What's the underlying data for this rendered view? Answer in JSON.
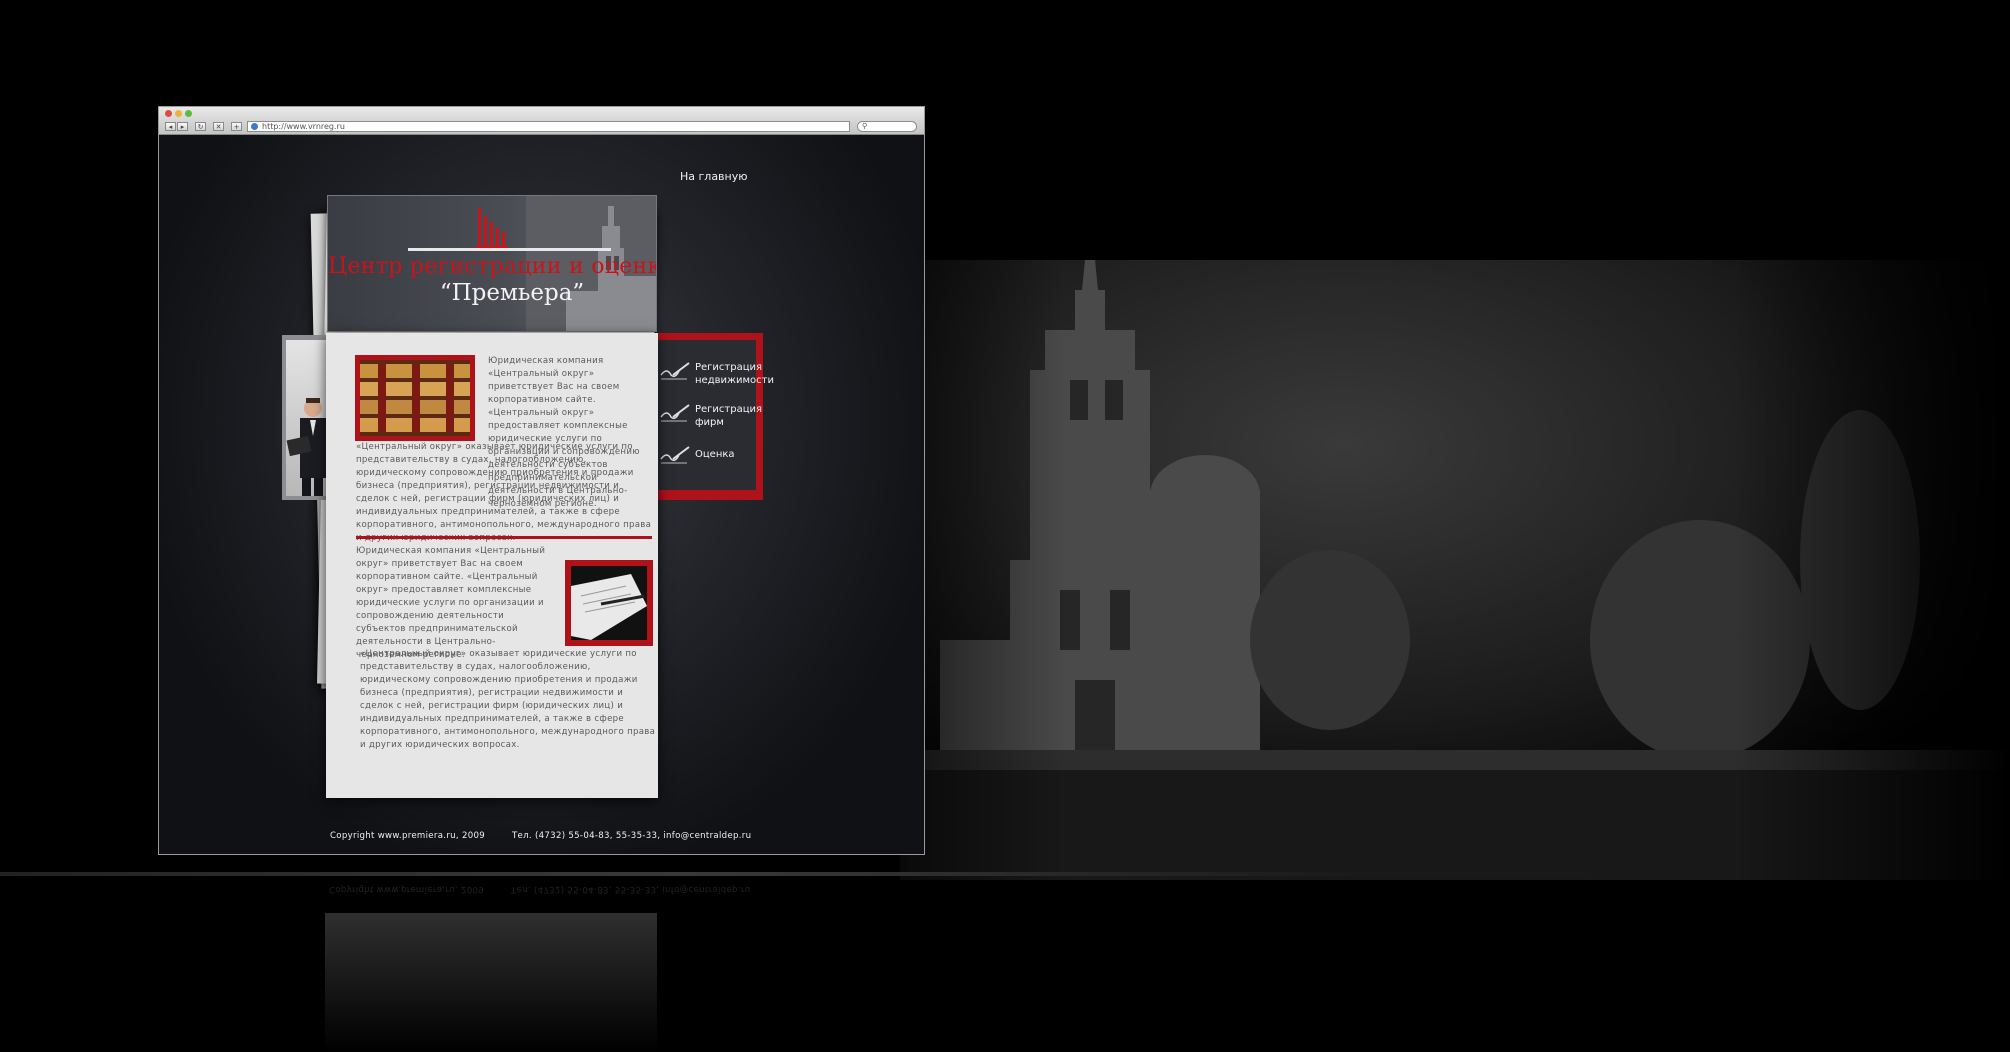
{
  "browser": {
    "url": "http://www.vrnreg.ru",
    "nav_buttons": [
      "◂",
      "▸",
      "↻",
      "✕",
      "+"
    ],
    "search_glyph": "⚲"
  },
  "site": {
    "home_link": "На главную",
    "title": "Центр регистрации и оценки",
    "subtitle": "“Премьера”",
    "menu": [
      {
        "label": "Регистрация\nнедвижимости"
      },
      {
        "label": "Регистрация\nфирм"
      },
      {
        "label": "Оценка"
      }
    ],
    "block1_intro": "Юридическая компания «Центральный округ» приветствует Вас на своем корпоративном сайте. «Центральный округ» предоставляет комплексные юридические услуги по организации и сопровождению деятельности субъектов предпринимательской деятельности в Центрально-черноземном регионе.",
    "block1_body": "«Центральный округ» оказывает юридические услуги по представительству в судах, налогообложению, юридическому сопровождению приобретения и продажи бизнеса (предприятия), регистрации недвижимости и сделок с ней, регистрации фирм (юридических лиц) и индивидуальных предпринимателей, а также в сфере корпоративного, антимонопольного, международного права и других юридических вопросах.",
    "block2_intro": "Юридическая компания «Центральный округ» приветствует Вас на своем корпоративном сайте. «Центральный округ» предоставляет комплексные юридические услуги по организации и сопровождению деятельности субъектов предпринимательской деятельности в Центрально-черноземном регионе.",
    "block2_body": "«Центральный округ» оказывает юридические услуги по представительству в судах, налогообложению, юридическому сопровождению приобретения и продажи бизнеса (предприятия), регистрации недвижимости и сделок с ней, регистрации фирм (юридических лиц) и индивидуальных предпринимателей, а также в сфере корпоративного, антимонопольного, международного права и других юридических вопросах.",
    "footer_copyright": "Copyright www.premiera.ru, 2009",
    "footer_contacts": "Тел. (4732) 55-04-83, 55-35-33, info@centraldep.ru"
  },
  "colors": {
    "accent_red": "#b0121a",
    "title_red": "#c8141a"
  }
}
